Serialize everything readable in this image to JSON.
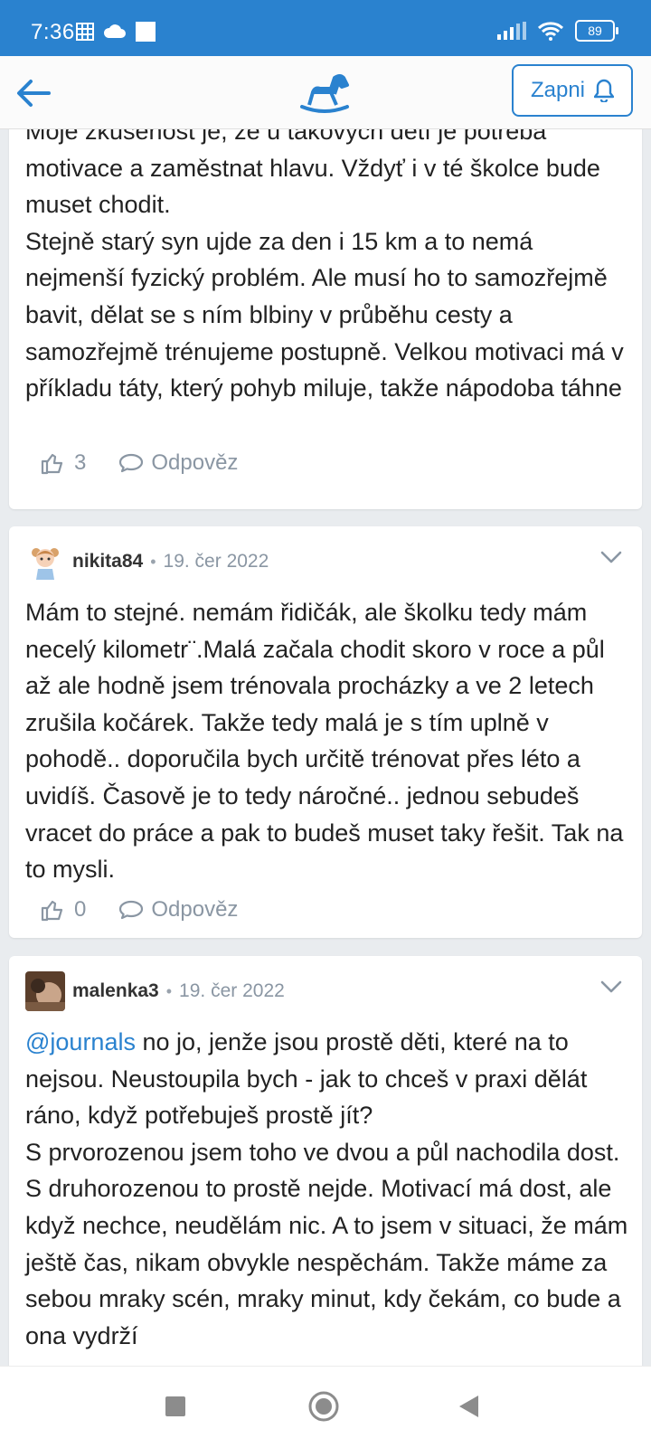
{
  "status_bar": {
    "time": "7:36",
    "battery": "89",
    "icons": [
      "grid-icon",
      "cloud-icon",
      "square-icon",
      "signal-icon",
      "wifi-icon",
      "battery-icon"
    ]
  },
  "header": {
    "logo": "rocking-horse-logo",
    "notify_label": "Zapni"
  },
  "comments": [
    {
      "text": "Moje zkušenost je, že u takových dětí je potřeba motivace a zaměstnat hlavu. Vždyť i v té školce bude muset chodit.\nStejně starý syn ujde za den i 15 km a to nemá nejmenší fyzický problém. Ale musí ho to samozřejmě bavit, dělat se s ním blbiny v průběhu cesty a samozřejmě trénujeme postupně. Velkou motivaci má v příkladu táty, který pohyb miluje, takže nápodoba táhne",
      "likes": "3",
      "reply_label": "Odpověz"
    },
    {
      "username": "nikita84",
      "date": "19. čer 2022",
      "text": "Mám to stejné. nemám řidičák, ale školku tedy mám necelý kilometr¨.Malá začala chodit skoro v roce a půl až ale hodně jsem trénovala procházky a ve 2 letech zrušila kočárek. Takže tedy malá je s tím uplně v pohodě.. doporučila bych určitě trénovat přes léto a uvidíš. Časově je to tedy náročné.. jednou sebudeš vracet do práce a pak to budeš muset taky řešit. Tak na to mysli.",
      "likes": "0",
      "reply_label": "Odpověz"
    },
    {
      "username": "malenka3",
      "date": "19. čer 2022",
      "mention": "@journals",
      "text": " no jo, jenže jsou prostě děti, které na to nejsou. Neustoupila bych - jak to chceš v praxi dělát ráno, když potřebuješ prostě jít?\nS prvorozenou jsem toho ve dvou a půl nachodila dost. S druhorozenou to prostě nejde. Motivací má dost, ale když nechce, neudělám nic. A to jsem v situaci, že mám ještě čas, nikam obvykle nespěchám. Takže máme za sebou mraky scén, mraky minut, kdy čekám, co bude a ona vydrží"
    }
  ]
}
